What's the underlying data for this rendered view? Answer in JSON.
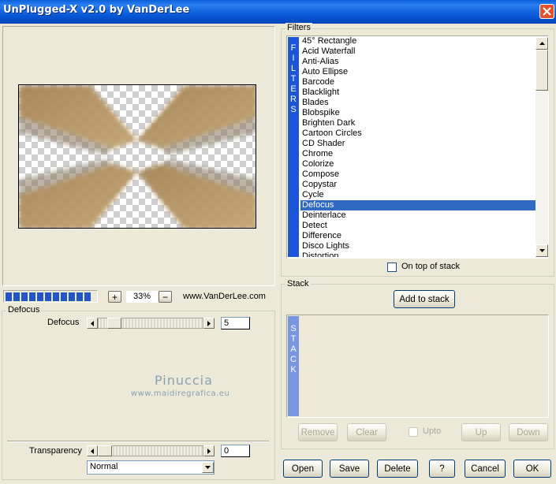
{
  "window": {
    "title": "UnPlugged-X v2.0 by VanDerLee"
  },
  "colors": {
    "titlebar": "#0a5fd8",
    "selection": "#316ac5",
    "filters_strip": "#1c55d8",
    "stack_strip": "#7a96e0",
    "progress": "#2256c8"
  },
  "icons": {
    "close": "close-icon"
  },
  "preview": {
    "progress_segments": 12,
    "zoom_in_label": "+",
    "zoom_value": "33%",
    "zoom_out_label": "−",
    "website": "www.VanDerLee.com"
  },
  "filters": {
    "group_label": "Filters",
    "strip_letters": [
      "F",
      "I",
      "L",
      "T",
      "E",
      "R",
      "S"
    ],
    "items": [
      "45° Rectangle",
      "Acid Waterfall",
      "Anti-Alias",
      "Auto Ellipse",
      "Barcode",
      "Blacklight",
      "Blades",
      "Blobspike",
      "Brighten Dark",
      "Cartoon Circles",
      "CD Shader",
      "Chrome",
      "Colorize",
      "Compose",
      "Copystar",
      "Cycle",
      "Defocus",
      "Deinterlace",
      "Detect",
      "Difference",
      "Disco Lights",
      "Distortion"
    ],
    "selected": "Defocus",
    "on_top_label": "On top of stack",
    "on_top_checked": false
  },
  "stack": {
    "group_label": "Stack",
    "add_label": "Add to stack",
    "strip_letters": [
      "S",
      "T",
      "A",
      "C",
      "K"
    ],
    "remove_label": "Remove",
    "clear_label": "Clear",
    "upto_label": "Upto",
    "up_label": "Up",
    "down_label": "Down"
  },
  "params": {
    "group_label": "Defocus",
    "defocus_label": "Defocus",
    "defocus_value": "5",
    "transparency_label": "Transparency",
    "transparency_value": "0",
    "blend_mode": "Normal"
  },
  "watermark": {
    "line1": "Pinuccia",
    "line2": "www.maidiregrafica.eu"
  },
  "buttons": {
    "open": "Open",
    "save": "Save",
    "delete": "Delete",
    "help": "?",
    "cancel": "Cancel",
    "ok": "OK"
  }
}
